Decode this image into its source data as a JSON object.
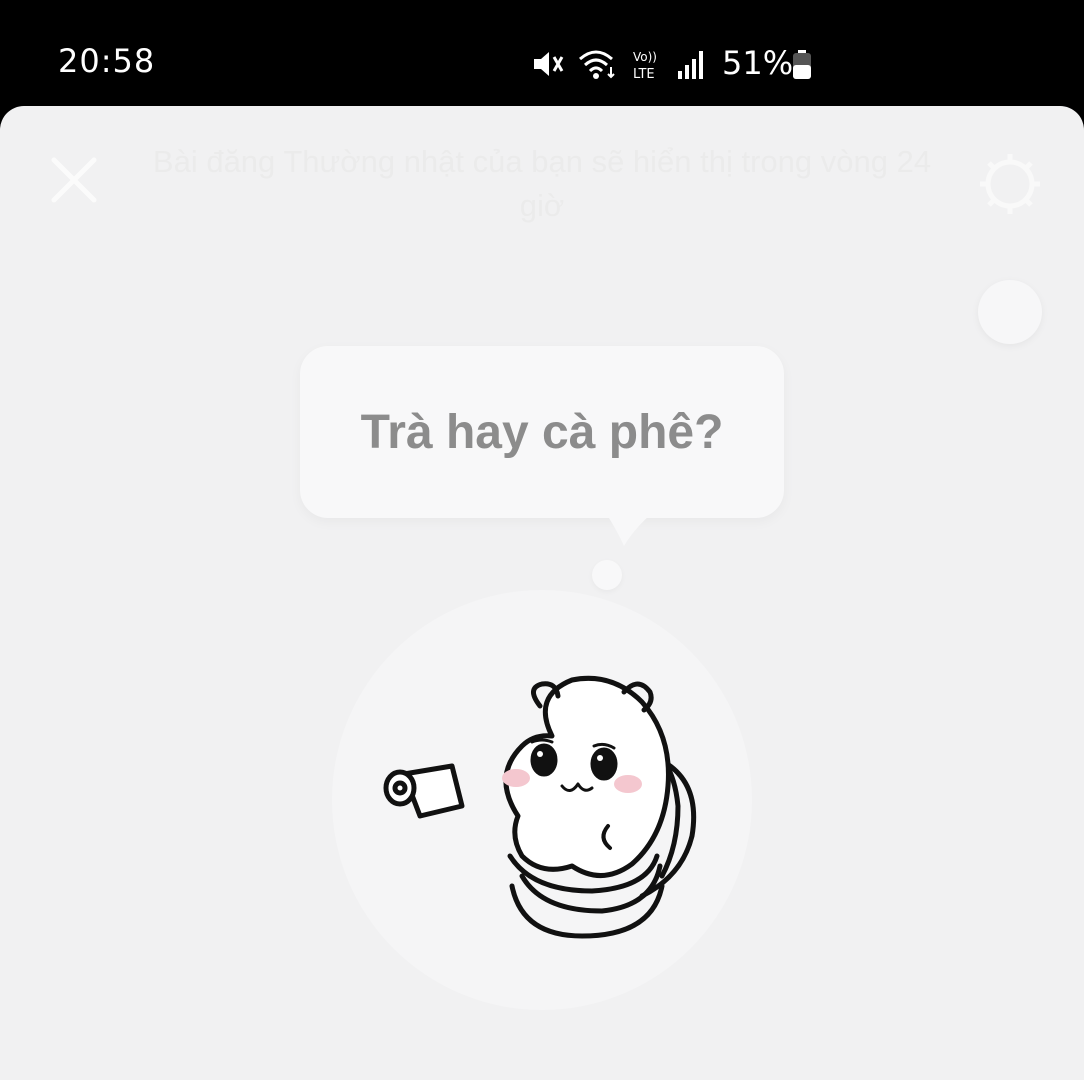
{
  "status_bar": {
    "time": "20:58",
    "battery_percent": "51%",
    "icons": [
      "mute-icon",
      "wifi-icon",
      "volte-lte-icon",
      "signal-icon",
      "battery-icon"
    ]
  },
  "header": {
    "notice": "Bài đăng Thường nhật của bạn sẽ hiển thị trong vòng 24 giờ",
    "close_icon": "close-icon",
    "settings_icon": "settings-icon"
  },
  "note": {
    "text": "Trà hay cà phê?"
  },
  "avatar": {
    "sticker": "hamster-on-toilet-sticker"
  },
  "colors": {
    "background": "#f1f1f2",
    "bubble": "#f8f8f9",
    "note_text": "#8c8c8c",
    "status_bar": "#000000"
  }
}
